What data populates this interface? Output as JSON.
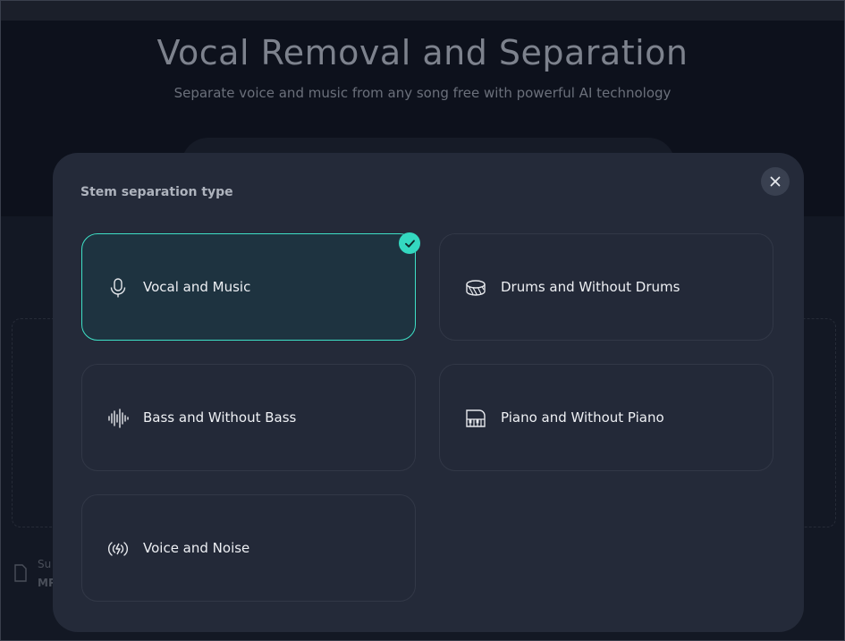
{
  "page": {
    "title": "Vocal Removal and Separation",
    "subtitle": "Separate voice and music from any song free with powerful AI technology",
    "supported_label": "Su",
    "formats_label": "MP"
  },
  "modal": {
    "heading": "Stem separation type",
    "close_icon": "close-icon",
    "options": [
      {
        "label": "Vocal and Music",
        "icon": "microphone-icon",
        "selected": true
      },
      {
        "label": "Drums and Without Drums",
        "icon": "drum-icon",
        "selected": false
      },
      {
        "label": "Bass and Without Bass",
        "icon": "sound-wave-icon",
        "selected": false
      },
      {
        "label": "Piano and Without Piano",
        "icon": "piano-icon",
        "selected": false
      },
      {
        "label": "Voice and Noise",
        "icon": "noise-icon",
        "selected": false
      }
    ]
  },
  "colors": {
    "accent": "#34d8c0",
    "modal_bg": "#242a39",
    "card_bg": "#232938",
    "selected_bg": "#1e3340"
  }
}
